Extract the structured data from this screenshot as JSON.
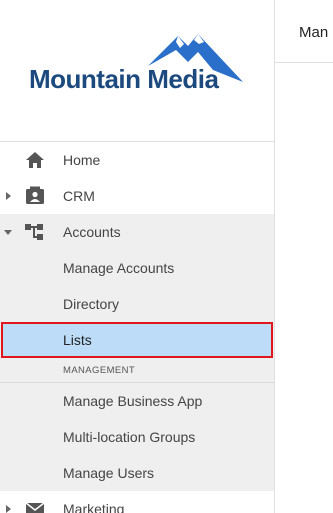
{
  "brand": {
    "name": "Mountain Media",
    "color": "#1c4a7e",
    "accent": "#2a6fc9"
  },
  "nav": {
    "home_label": "Home",
    "crm_label": "CRM",
    "accounts_label": "Accounts",
    "accounts_sub": {
      "manage_accounts": "Manage Accounts",
      "directory": "Directory",
      "lists": "Lists",
      "management_header": "MANAGEMENT",
      "manage_business_app": "Manage Business App",
      "multi_location_groups": "Multi-location Groups",
      "manage_users": "Manage Users"
    },
    "marketing_label": "Marketing"
  },
  "main": {
    "title": "Man"
  },
  "colors": {
    "active_bg": "#bcdcf8",
    "highlight_border": "#e0161b",
    "sub_bg": "#efefef"
  }
}
